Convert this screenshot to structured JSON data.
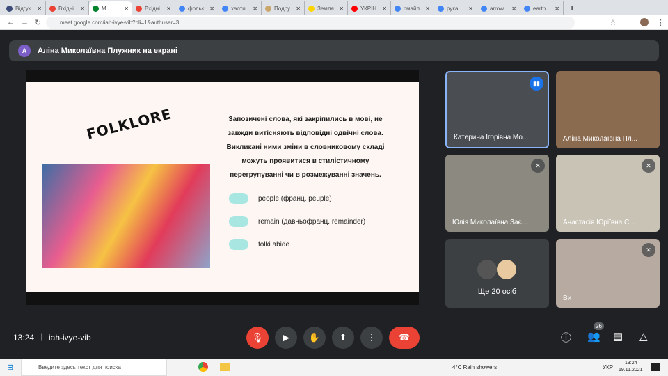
{
  "browser": {
    "tabs": [
      {
        "label": "Відгук",
        "color": "#3d4b7a"
      },
      {
        "label": "Вхідні",
        "color": "#ea4335"
      },
      {
        "label": "M",
        "color": "#00832d",
        "active": true
      },
      {
        "label": "Вхідні",
        "color": "#ea4335"
      },
      {
        "label": "фольк",
        "color": "#4285f4"
      },
      {
        "label": "хаоти",
        "color": "#4285f4"
      },
      {
        "label": "Подру",
        "color": "#c9a66b"
      },
      {
        "label": "Земля",
        "color": "#ffd500"
      },
      {
        "label": "УКРІН",
        "color": "#ff0000"
      },
      {
        "label": "смайл",
        "color": "#4285f4"
      },
      {
        "label": "рука",
        "color": "#4285f4"
      },
      {
        "label": "arrow",
        "color": "#4285f4"
      },
      {
        "label": "earth",
        "color": "#4285f4"
      }
    ],
    "url": "meet.google.com/iah-ivye-vib?pli=1&authuser=3"
  },
  "meet": {
    "presenter_banner": "Аліна Миколаївна Плужник на екрані",
    "presenter_initial": "A",
    "slide": {
      "title": "FOLKLORE",
      "paragraph": "Запозичені слова, які закріпились в мові, не завжди витісняють відповідні одвічні слова. Викликані ними зміни в словниковому складі можуть проявитися в стилістичному перегрупуванні чи в розмежуванні значень.",
      "bullets": [
        "people (франц. peuple)",
        "remain (давньофранц. remainder)",
        "folki abide"
      ]
    },
    "participants": [
      {
        "name": "Катерина Ігорівна Мо...",
        "speaking": true
      },
      {
        "name": "Аліна Миколаївна Пл..."
      },
      {
        "name": "Юлія Миколаївна Зає...",
        "muted": true
      },
      {
        "name": "Анастасія Юріївна С...",
        "muted": true
      },
      {
        "name": "Ще 20 осіб"
      },
      {
        "name": "Ви",
        "muted": true
      }
    ],
    "time": "13:24",
    "meeting_code": "iah-ivye-vib",
    "participant_count": "26",
    "accent": "#8ab4f8",
    "end_call_color": "#ea4335"
  },
  "taskbar": {
    "search_placeholder": "Введите здесь текст для поиска",
    "weather": "4°C  Rain showers",
    "lang": "УКР",
    "clock_time": "13:24",
    "clock_date": "19.11.2021"
  }
}
